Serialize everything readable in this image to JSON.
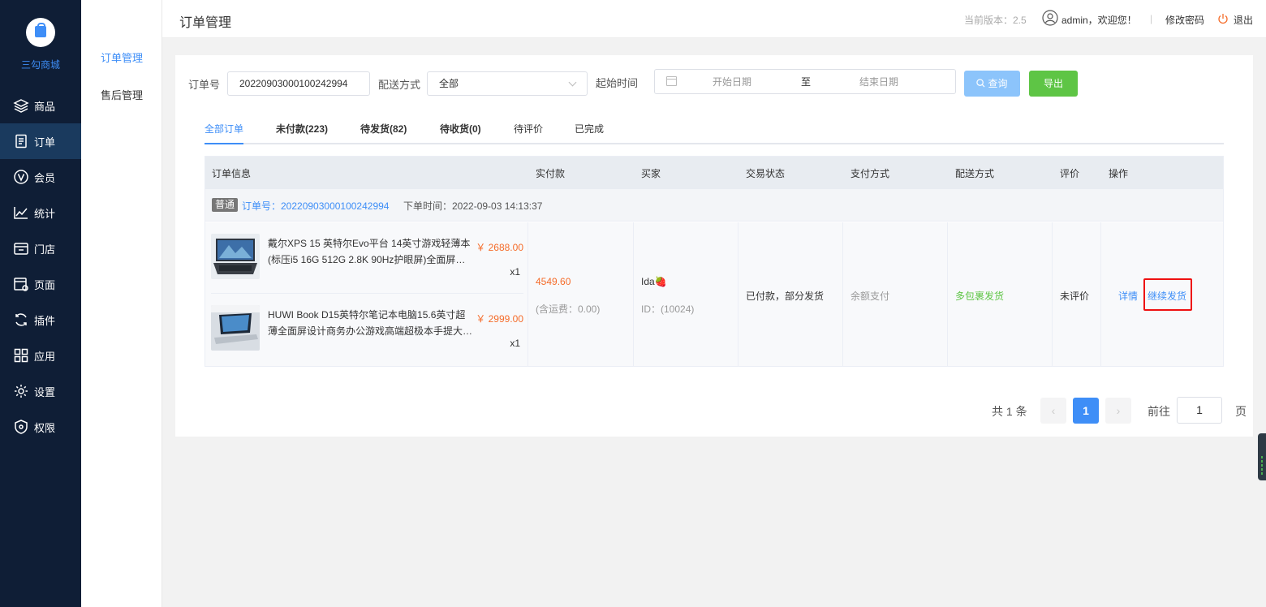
{
  "sidebar": {
    "logo_text": "三勾商城",
    "items": [
      {
        "label": "商品",
        "icon": "layers-icon"
      },
      {
        "label": "订单",
        "icon": "order-list-icon"
      },
      {
        "label": "会员",
        "icon": "vip-icon"
      },
      {
        "label": "统计",
        "icon": "chart-line-icon"
      },
      {
        "label": "门店",
        "icon": "store-icon"
      },
      {
        "label": "页面",
        "icon": "page-settings-icon"
      },
      {
        "label": "插件",
        "icon": "plugin-refresh-icon"
      },
      {
        "label": "应用",
        "icon": "apps-grid-icon"
      },
      {
        "label": "设置",
        "icon": "gear-icon"
      },
      {
        "label": "权限",
        "icon": "shield-icon"
      }
    ],
    "active_index": 1
  },
  "submenu": {
    "items": [
      {
        "label": "订单管理"
      },
      {
        "label": "售后管理"
      }
    ]
  },
  "header": {
    "title": "订单管理",
    "version": "当前版本：2.5",
    "user_greeting": "admin，欢迎您！",
    "separator": "|",
    "change_password": "修改密码",
    "logout": "退出"
  },
  "filters": {
    "order_no_label": "订单号",
    "order_no_value": "20220903000100242994",
    "delivery_label": "配送方式",
    "delivery_value": "全部",
    "start_time_label": "起始时间",
    "start_date_placeholder": "开始日期",
    "range_separator": "至",
    "end_date_placeholder": "结束日期",
    "query_button": "查询",
    "export_button": "导出"
  },
  "tabs": [
    {
      "label": "全部订单",
      "active": true
    },
    {
      "label": "未付款(223)"
    },
    {
      "label": "待发货(82)"
    },
    {
      "label": "待收货(0)"
    },
    {
      "label": "待评价"
    },
    {
      "label": "已完成"
    }
  ],
  "table": {
    "columns": [
      "订单信息",
      "实付款",
      "买家",
      "交易状态",
      "支付方式",
      "配送方式",
      "评价",
      "操作"
    ],
    "order": {
      "type_badge": "普通",
      "order_no": "订单号：20220903000100242994",
      "order_time": "下单时间：2022-09-03 14:13:37",
      "products": [
        {
          "name": "戴尔XPS 15 英特尔Evo平台 14英寸游戏轻薄本(标压i5 16G 512G 2.8K 90Hz护眼屏)全面屏…",
          "price": "￥ 2688.00",
          "qty": "x1"
        },
        {
          "name": "HUWI Book D15英特尔笔记本电脑15.6英寸超薄全面屏设计商务办公游戏高端超极本手提大…",
          "price": "￥ 2999.00",
          "qty": "x1"
        }
      ],
      "paid_amount": "4549.60",
      "shipping_note": "(含运费：0.00)",
      "buyer_name": "Ida🍓",
      "buyer_id": "ID：(10024)",
      "trade_status": "已付款，部分发货",
      "pay_method": "余额支付",
      "delivery_method": "多包裹发货",
      "review_status": "未评价",
      "action_detail": "详情",
      "action_continue": "继续发货"
    }
  },
  "pagination": {
    "total": "共 1 条",
    "prev": "‹",
    "current_page": "1",
    "next": "›",
    "goto_label": "前往",
    "goto_value": "1",
    "page_suffix": "页"
  },
  "colors": {
    "sidebar_bg": "#0f1e36",
    "accent": "#3e8ef7",
    "export_green": "#5ec545",
    "price_orange": "#f56c2a",
    "delivery_green": "#5ec545",
    "highlight_red": "#ee1111"
  }
}
